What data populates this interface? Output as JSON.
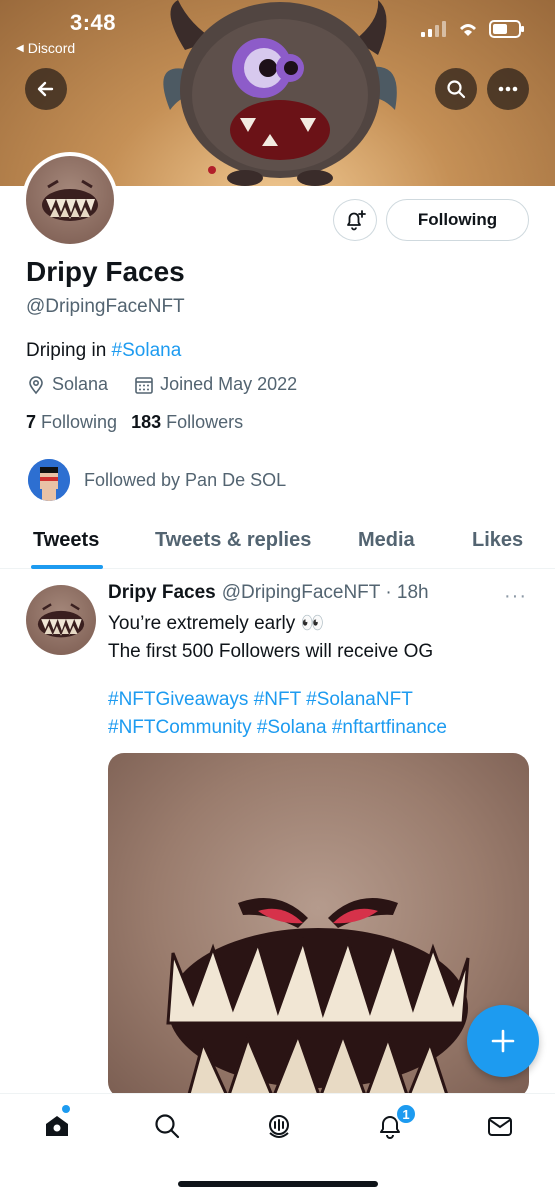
{
  "status_bar": {
    "time": "3:48",
    "back_app": "Discord"
  },
  "header": {
    "back_icon": "arrow-left-icon",
    "search_icon": "search-icon",
    "more_icon": "more-horizontal-icon"
  },
  "profile": {
    "name": "Dripy Faces",
    "handle": "@DripingFaceNFT",
    "bio_text": "Driping in ",
    "bio_hashtag": "#Solana",
    "location": "Solana",
    "joined": "Joined May 2022",
    "following_count": "7",
    "following_label": "Following",
    "followers_count": "183",
    "followers_label": "Followers",
    "followed_by": "Followed by Pan De SOL",
    "following_button": "Following"
  },
  "tabs": [
    {
      "label": "Tweets",
      "active": true
    },
    {
      "label": "Tweets & replies",
      "active": false
    },
    {
      "label": "Media",
      "active": false
    },
    {
      "label": "Likes",
      "active": false
    }
  ],
  "tweet": {
    "author": "Dripy Faces",
    "handle_time": "@DripingFaceNFT · 18h",
    "line1": "You’re extremely early 👀",
    "line2": "The first 500 Followers will receive OG",
    "hashtags_line1": "#NFTGiveaways #NFT  #SolanaNFT",
    "hashtags_line2": "#NFTCommunity #Solana #nftartfinance",
    "more": "···"
  },
  "bottom_nav": {
    "items": [
      "home-icon",
      "search-icon",
      "spaces-icon",
      "notifications-icon",
      "messages-icon"
    ],
    "notification_badge": "1"
  },
  "colors": {
    "accent": "#1d9bf0",
    "text_primary": "#0f1419",
    "text_secondary": "#536471"
  }
}
